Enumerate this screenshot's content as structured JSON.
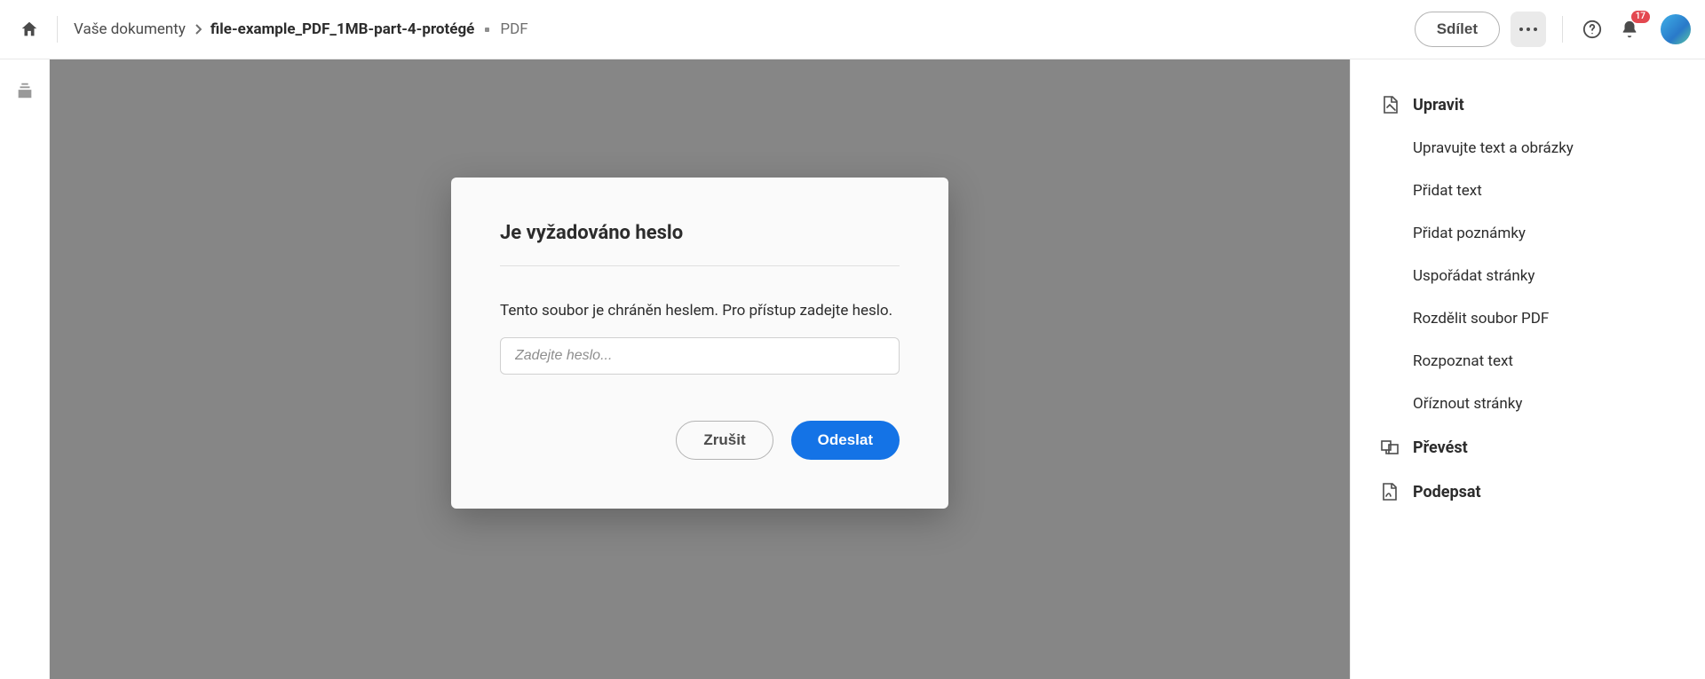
{
  "header": {
    "breadcrumb_root": "Vaše dokumenty",
    "file_name": "file-example_PDF_1MB-part-4-protégé",
    "file_type": "PDF",
    "share_label": "Sdílet",
    "notif_count": "17"
  },
  "right_panel": {
    "edit": {
      "title": "Upravit",
      "items": [
        "Upravujte text a obrázky",
        "Přidat text",
        "Přidat poznámky",
        "Uspořádat stránky",
        "Rozdělit soubor PDF",
        "Rozpoznat text",
        "Oříznout stránky"
      ]
    },
    "convert_title": "Převést",
    "sign_title": "Podepsat"
  },
  "modal": {
    "title": "Je vyžadováno heslo",
    "message": "Tento soubor je chráněn heslem. Pro přístup zadejte heslo.",
    "placeholder": "Zadejte heslo...",
    "cancel": "Zrušit",
    "submit": "Odeslat"
  }
}
